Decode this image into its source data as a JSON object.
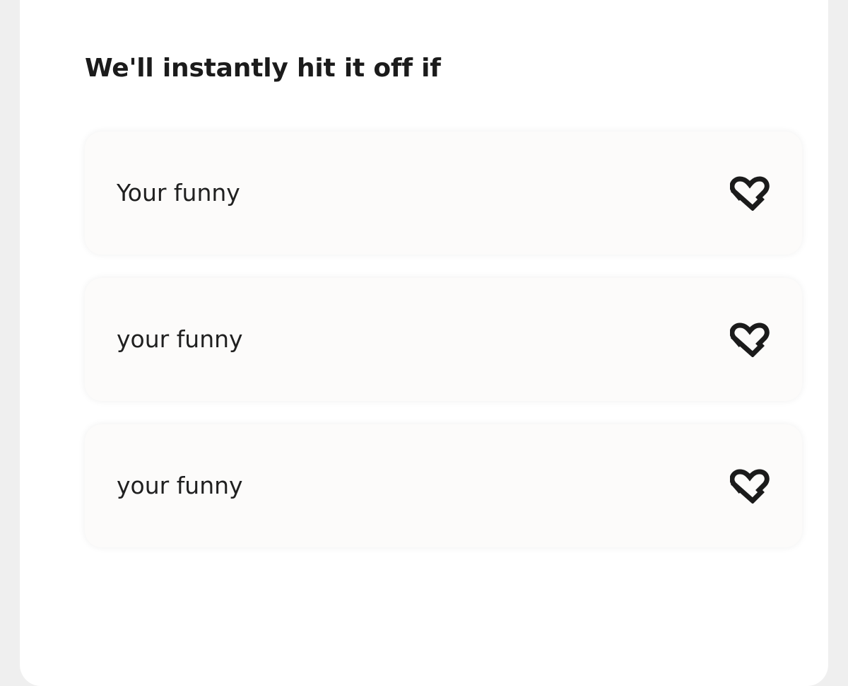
{
  "prompt": {
    "title": "We'll instantly hit it off if"
  },
  "answers": [
    {
      "text": "Your funny",
      "icon": "heart-like-icon"
    },
    {
      "text": "your funny",
      "icon": "heart-like-icon"
    },
    {
      "text": "your funny",
      "icon": "heart-like-icon"
    }
  ],
  "colors": {
    "page_background": "#efefef",
    "card_background": "#ffffff",
    "answer_background": "#fcfbfa",
    "text": "#1b1b1b"
  }
}
